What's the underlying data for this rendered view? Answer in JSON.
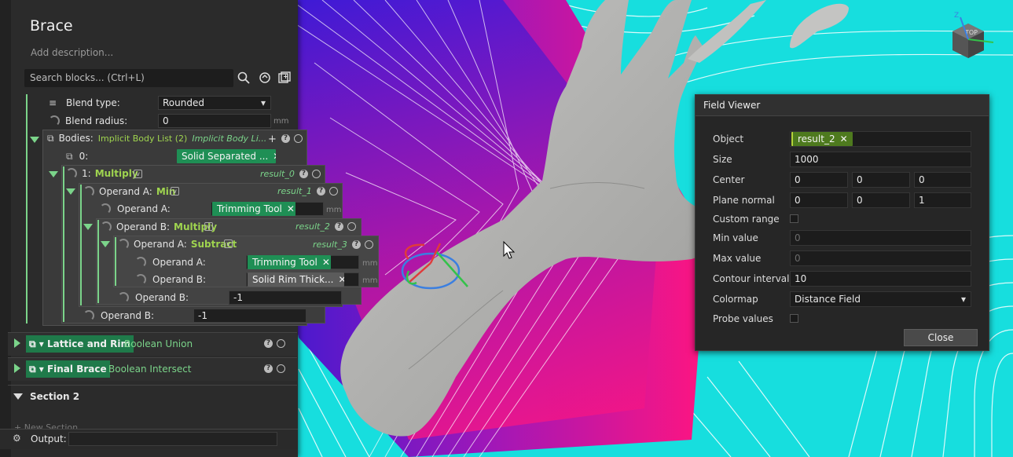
{
  "panel": {
    "title": "Brace",
    "description_placeholder": "Add description...",
    "search_placeholder": "Search blocks... (Ctrl+L)",
    "blend_type_label": "Blend type:",
    "blend_type_value": "Rounded",
    "blend_radius_label": "Blend radius:",
    "blend_radius_value": "0",
    "unit_mm": "mm",
    "bodies_label": "Bodies:",
    "bodies_type": "Implicit Body List (2)",
    "bodies_type2": "Implicit Body Li...",
    "item0_label": "0:",
    "item0_chip": "Solid Separated ...",
    "item1_label": "1:",
    "multiply": "Multiply",
    "min": "Min",
    "subtract": "Subtract",
    "result_0": "result_0",
    "result_1": "result_1",
    "result_2": "result_2",
    "result_3": "result_3",
    "operand_a": "Operand A:",
    "operand_b": "Operand B:",
    "trimming_tool": "Trimming Tool",
    "solid_rim": "Solid Rim Thick...",
    "neg1": "-1",
    "lattice_tag": "Lattice and Rim",
    "lattice_op": "Boolean Union",
    "final_tag": "Final Brace",
    "final_op": "Boolean Intersect",
    "section2": "Section 2",
    "new_section": "+ New Section",
    "output_label": "Output:"
  },
  "field_viewer": {
    "title": "Field Viewer",
    "object_label": "Object",
    "object_value": "result_2",
    "size_label": "Size",
    "size_value": "1000",
    "center_label": "Center",
    "center": [
      "0",
      "0",
      "0"
    ],
    "normal_label": "Plane normal",
    "normal": [
      "0",
      "0",
      "1"
    ],
    "custom_range_label": "Custom range",
    "min_label": "Min value",
    "min_value": "0",
    "max_label": "Max value",
    "max_value": "0",
    "contour_label": "Contour interval",
    "contour_value": "10",
    "colormap_label": "Colormap",
    "colormap_value": "Distance Field",
    "probe_label": "Probe values",
    "close_label": "Close"
  },
  "viewcube": {
    "label": "TOP",
    "axis_z": "Z"
  },
  "colors": {
    "accent_green": "#7bd48a",
    "chip_green": "#1f8f55",
    "field_cyan": "#19e0e0",
    "field_magenta": "#e0187a"
  }
}
